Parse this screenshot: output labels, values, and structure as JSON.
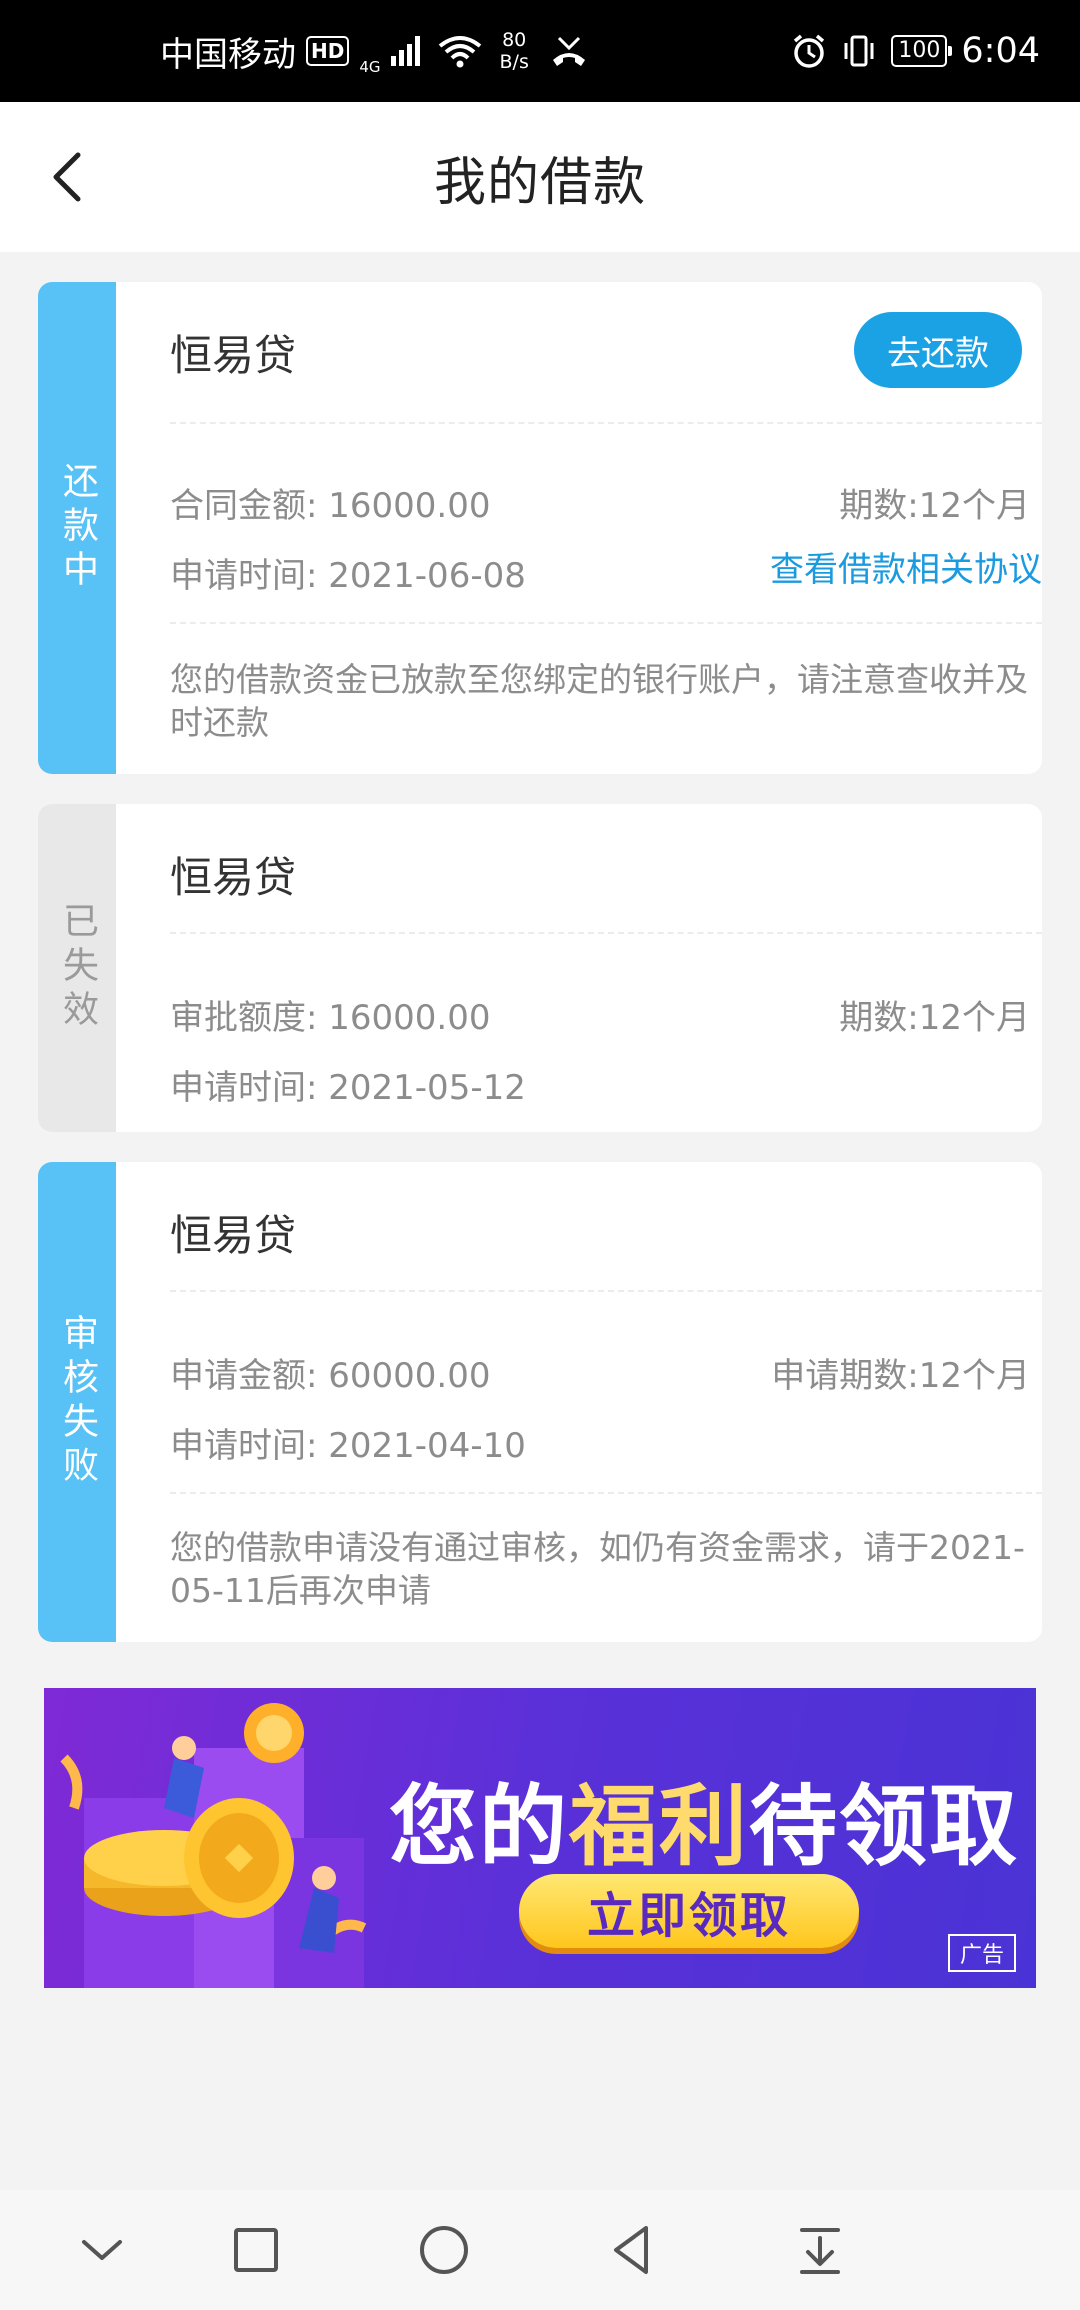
{
  "status_bar": {
    "carrier": "中国移动",
    "hd": "HD",
    "network": "4G",
    "speed_value": "80",
    "speed_unit": "B/s",
    "battery": "100",
    "time": "6:04"
  },
  "header": {
    "title": "我的借款"
  },
  "loans": [
    {
      "status": "还款中",
      "product": "恒易贷",
      "action_label": "去还款",
      "amount_label": "合同金额: 16000.00",
      "term_label": "期数:12个月",
      "date_label": "申请时间: 2021-06-08",
      "link_label": "查看借款相关协议",
      "note": "您的借款资金已放款至您绑定的银行账户，请注意查收并及时还款"
    },
    {
      "status": "已失效",
      "product": "恒易贷",
      "amount_label": "审批额度: 16000.00",
      "term_label": "期数:12个月",
      "date_label": "申请时间: 2021-05-12"
    },
    {
      "status": "审核失败",
      "product": "恒易贷",
      "amount_label": "申请金额: 60000.00",
      "term_label": "申请期数:12个月",
      "date_label": "申请时间: 2021-04-10",
      "note": "您的借款申请没有通过审核，如仍有资金需求，请于2021-05-11后再次申请"
    }
  ],
  "ad": {
    "headline_prefix": "您的",
    "headline_highlight": "福利",
    "headline_suffix": "待领取",
    "cta": "立即领取",
    "tag": "广告"
  },
  "colors": {
    "accent": "#1aa2e5",
    "active_side": "#58c1f5",
    "inactive_side": "#e8e8e8",
    "link": "#1a9be0"
  },
  "icons": {
    "back": "chevron-left-icon",
    "nav": [
      "chevron-down-icon",
      "square-icon",
      "circle-icon",
      "triangle-left-icon",
      "download-bar-icon"
    ]
  }
}
